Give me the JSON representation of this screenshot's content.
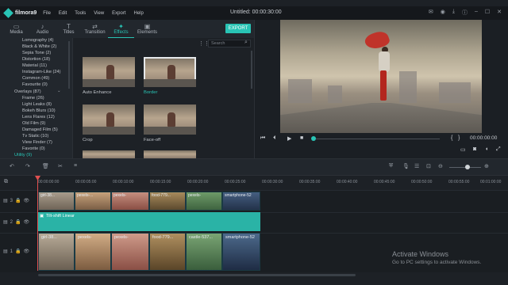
{
  "app": {
    "name": "filmora9",
    "title": "Untitled: 00:00:30:00"
  },
  "menu": [
    "File",
    "Edit",
    "Tools",
    "View",
    "Export",
    "Help"
  ],
  "tabs": [
    {
      "label": "Media",
      "icon": "folder-icon"
    },
    {
      "label": "Audio",
      "icon": "music-icon"
    },
    {
      "label": "Titles",
      "icon": "text-icon"
    },
    {
      "label": "Transition",
      "icon": "transition-icon"
    },
    {
      "label": "Effects",
      "icon": "effects-icon",
      "active": true
    },
    {
      "label": "Elements",
      "icon": "elements-icon"
    }
  ],
  "export_label": "EXPORT",
  "search": {
    "placeholder": "Search"
  },
  "categories": [
    {
      "label": "Lomography (4)",
      "type": "sub"
    },
    {
      "label": "Black & White (2)",
      "type": "sub"
    },
    {
      "label": "Sepia Tone (2)",
      "type": "sub"
    },
    {
      "label": "Distortion (18)",
      "type": "sub"
    },
    {
      "label": "Material (11)",
      "type": "sub"
    },
    {
      "label": "Instagram-Like (24)",
      "type": "sub"
    },
    {
      "label": "Common (49)",
      "type": "sub"
    },
    {
      "label": "Favourite (0)",
      "type": "sub"
    },
    {
      "label": "Overlays (87)",
      "type": "group"
    },
    {
      "label": "Frame (26)",
      "type": "sub"
    },
    {
      "label": "Light Leaks (8)",
      "type": "sub"
    },
    {
      "label": "Bokeh Blurs (10)",
      "type": "sub"
    },
    {
      "label": "Lens Flares (12)",
      "type": "sub"
    },
    {
      "label": "Old Film (9)",
      "type": "sub"
    },
    {
      "label": "Damaged Film (5)",
      "type": "sub"
    },
    {
      "label": "Tv Static (10)",
      "type": "sub"
    },
    {
      "label": "View Finder (7)",
      "type": "sub"
    },
    {
      "label": "Favorite (0)",
      "type": "sub"
    },
    {
      "label": "Utility (9)",
      "type": "group",
      "selected": true
    }
  ],
  "effects": [
    {
      "label": "Auto Enhance"
    },
    {
      "label": "Border",
      "selected": true
    },
    {
      "label": "Crop"
    },
    {
      "label": "Face-off"
    }
  ],
  "player": {
    "time": "00:00:00:00",
    "progress": 0
  },
  "ruler": [
    "00:00:00:00",
    "00:00:05:00",
    "00:00:10:00",
    "00:00:15:00",
    "00:00:20:00",
    "00:00:25:00",
    "00:00:30:00",
    "00:00:35:00",
    "00:00:40:00",
    "00:00:45:00",
    "00:00:50:00",
    "00:00:55:00",
    "00:01:00:00"
  ],
  "track3_clips": [
    "girl-38...",
    "pexels-...",
    "pexels-",
    "food-779...",
    "pexels-",
    "smartphone-52"
  ],
  "effect_clip": "Tilt-shift Linear",
  "track1_clips": [
    "girl-38...",
    "pexels-",
    "pexels-",
    "food-779...",
    "castle-537...",
    "smartphone-52"
  ],
  "track_numbers": [
    "3",
    "2",
    "1"
  ],
  "watermark": {
    "title": "Activate Windows",
    "subtitle": "Go to PC settings to activate Windows."
  }
}
